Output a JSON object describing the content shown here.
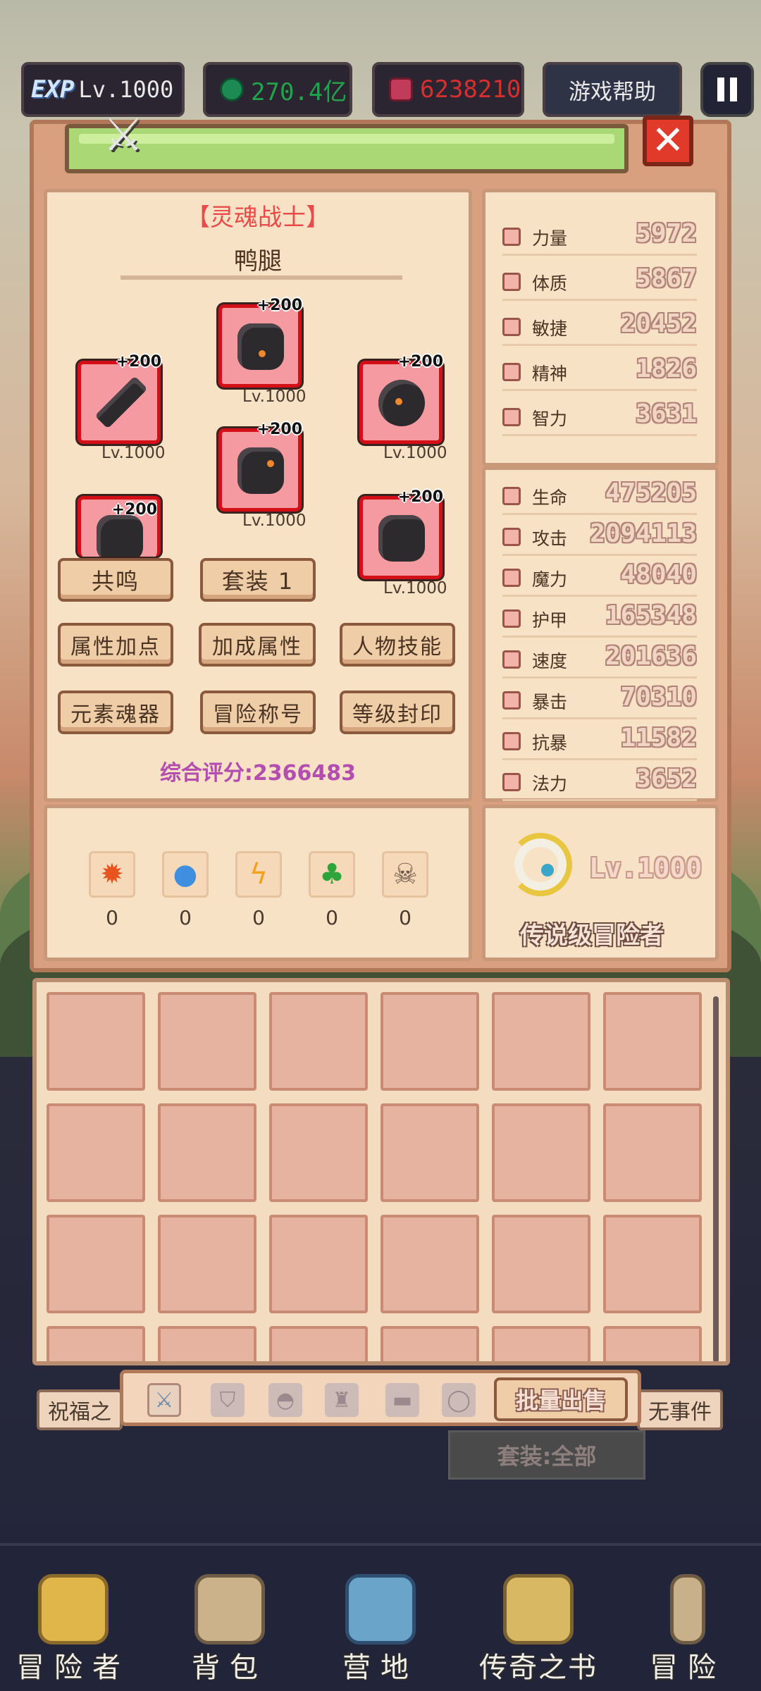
{
  "topbar": {
    "level": "Lv.1000",
    "exp_badge": "EXP",
    "gems": "270.4亿",
    "rubies": "6238210",
    "help_label": "游戏帮助"
  },
  "character": {
    "class_title": "【灵魂战士】",
    "name": "鸭腿",
    "score_text": "综合评分:2366483"
  },
  "equipment": [
    {
      "slot": "helmet",
      "plus": "+200",
      "level": "Lv.1000"
    },
    {
      "slot": "weapon",
      "plus": "+200",
      "level": "Lv.1000"
    },
    {
      "slot": "shield",
      "plus": "+200",
      "level": "Lv.1000"
    },
    {
      "slot": "armor",
      "plus": "+200",
      "level": "Lv.1000"
    },
    {
      "slot": "gloves",
      "plus": "+200",
      "level": ""
    },
    {
      "slot": "boots",
      "plus": "+200",
      "level": "Lv.1000"
    }
  ],
  "buttons": {
    "resonance": "共鸣",
    "set": "套装 1",
    "attr_points": "属性加点",
    "bonus_attr": "加成属性",
    "skills": "人物技能",
    "element_soul": "元素魂器",
    "adventure_title": "冒险称号",
    "level_seal": "等级封印"
  },
  "elements": [
    {
      "icon": "fire-icon",
      "count": "0"
    },
    {
      "icon": "water-icon",
      "count": "0"
    },
    {
      "icon": "lightning-icon",
      "count": "0"
    },
    {
      "icon": "leaf-icon",
      "count": "0"
    },
    {
      "icon": "skull-icon",
      "count": "0"
    }
  ],
  "base_stats": [
    {
      "label": "力量",
      "value": "5972"
    },
    {
      "label": "体质",
      "value": "5867"
    },
    {
      "label": "敏捷",
      "value": "20452"
    },
    {
      "label": "精神",
      "value": "1826"
    },
    {
      "label": "智力",
      "value": "3631"
    }
  ],
  "combat_stats": [
    {
      "label": "生命",
      "value": "475205"
    },
    {
      "label": "攻击",
      "value": "2094113"
    },
    {
      "label": "魔力",
      "value": "48040"
    },
    {
      "label": "护甲",
      "value": "165348"
    },
    {
      "label": "速度",
      "value": "201636"
    },
    {
      "label": "暴击",
      "value": "70310"
    },
    {
      "label": "抗暴",
      "value": "11582"
    },
    {
      "label": "法力",
      "value": "3652"
    }
  ],
  "rank": {
    "level": "Lv.1000",
    "name": "传说级冒险者"
  },
  "inventory": {
    "sell_label": "批量出售",
    "filter_label": "套装:全部",
    "tabs": [
      "sword-icon",
      "shield-icon",
      "helmet-icon",
      "armor-icon",
      "belt-icon",
      "ring-icon"
    ]
  },
  "background": {
    "left_chip": "祝福之",
    "right_chip": "无事件"
  },
  "nav": [
    {
      "label": "冒险者",
      "icon": "crown-icon"
    },
    {
      "label": "背包",
      "icon": "backpack-icon"
    },
    {
      "label": "营地",
      "icon": "camp-icon"
    },
    {
      "label": "传奇之书",
      "icon": "book-icon"
    },
    {
      "label": "冒险",
      "icon": "sword-icon"
    }
  ],
  "colors": {
    "accent_red": "#e94a4a",
    "score_purple": "#b34db0",
    "panel": "#f7e2c5"
  }
}
